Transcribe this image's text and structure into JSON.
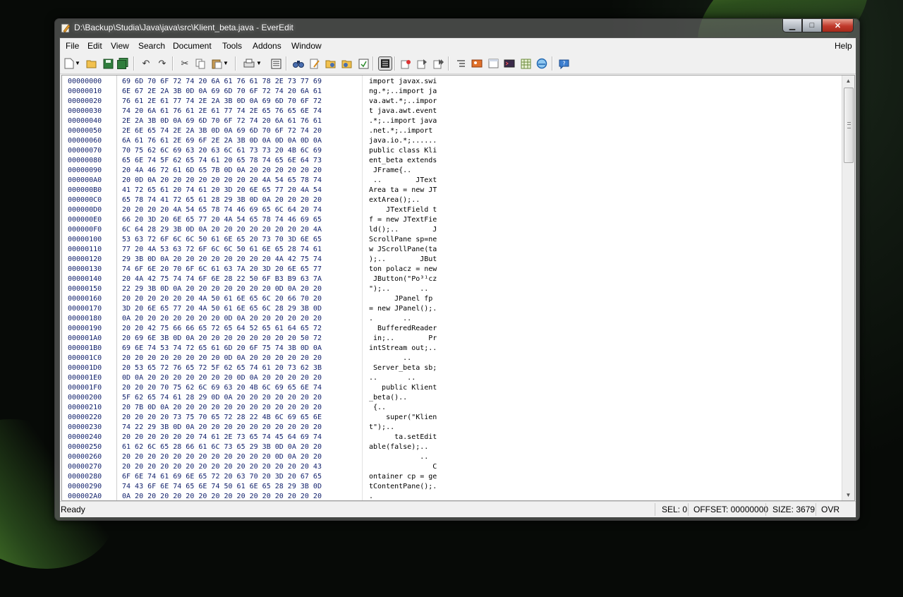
{
  "window": {
    "title": "D:\\Backup\\Studia\\Java\\java\\src\\Klient_beta.java - EverEdit",
    "controls": {
      "minimize": "▁",
      "maximize": "□",
      "close": "✕"
    }
  },
  "menu": {
    "file": "File",
    "edit": "Edit",
    "view": "View",
    "search": "Search",
    "document": "Document",
    "tools": "Tools",
    "addons": "Addons",
    "window": "Window",
    "help": "Help"
  },
  "toolbar": {
    "icons": [
      "new-icon",
      "open-icon",
      "save-icon",
      "save-all-icon",
      "undo-icon",
      "redo-icon",
      "cut-icon",
      "copy-icon",
      "paste-icon",
      "print-icon",
      "preview-icon",
      "find-icon",
      "replace-icon",
      "find-files-icon",
      "goto-icon",
      "hex-mode-icon",
      "record-icon",
      "play-icon",
      "play-multiple-icon",
      "outline-icon",
      "image-icon",
      "window-icon",
      "terminal-icon",
      "table-icon",
      "browser-icon",
      "help-icon"
    ]
  },
  "hex_rows": [
    {
      "off": "00000000",
      "hex": "69 6D 70 6F 72 74 20 6A 61 76 61 78 2E 73 77 69",
      "asc": "import javax.swi"
    },
    {
      "off": "00000010",
      "hex": "6E 67 2E 2A 3B 0D 0A 69 6D 70 6F 72 74 20 6A 61",
      "asc": "ng.*;..import ja"
    },
    {
      "off": "00000020",
      "hex": "76 61 2E 61 77 74 2E 2A 3B 0D 0A 69 6D 70 6F 72",
      "asc": "va.awt.*;..impor"
    },
    {
      "off": "00000030",
      "hex": "74 20 6A 61 76 61 2E 61 77 74 2E 65 76 65 6E 74",
      "asc": "t java.awt.event"
    },
    {
      "off": "00000040",
      "hex": "2E 2A 3B 0D 0A 69 6D 70 6F 72 74 20 6A 61 76 61",
      "asc": ".*;..import java"
    },
    {
      "off": "00000050",
      "hex": "2E 6E 65 74 2E 2A 3B 0D 0A 69 6D 70 6F 72 74 20",
      "asc": ".net.*;..import "
    },
    {
      "off": "00000060",
      "hex": "6A 61 76 61 2E 69 6F 2E 2A 3B 0D 0A 0D 0A 0D 0A",
      "asc": "java.io.*;......"
    },
    {
      "off": "00000070",
      "hex": "70 75 62 6C 69 63 20 63 6C 61 73 73 20 4B 6C 69",
      "asc": "public class Kli"
    },
    {
      "off": "00000080",
      "hex": "65 6E 74 5F 62 65 74 61 20 65 78 74 65 6E 64 73",
      "asc": "ent_beta extends"
    },
    {
      "off": "00000090",
      "hex": "20 4A 46 72 61 6D 65 7B 0D 0A 20 20 20 20 20 20",
      "asc": " JFrame{..      "
    },
    {
      "off": "000000A0",
      "hex": "20 0D 0A 20 20 20 20 20 20 20 20 4A 54 65 78 74",
      "asc": " ..        JText"
    },
    {
      "off": "000000B0",
      "hex": "41 72 65 61 20 74 61 20 3D 20 6E 65 77 20 4A 54",
      "asc": "Area ta = new JT"
    },
    {
      "off": "000000C0",
      "hex": "65 78 74 41 72 65 61 28 29 3B 0D 0A 20 20 20 20",
      "asc": "extArea();..    "
    },
    {
      "off": "000000D0",
      "hex": "20 20 20 20 4A 54 65 78 74 46 69 65 6C 64 20 74",
      "asc": "    JTextField t"
    },
    {
      "off": "000000E0",
      "hex": "66 20 3D 20 6E 65 77 20 4A 54 65 78 74 46 69 65",
      "asc": "f = new JTextFie"
    },
    {
      "off": "000000F0",
      "hex": "6C 64 28 29 3B 0D 0A 20 20 20 20 20 20 20 20 4A",
      "asc": "ld();..        J"
    },
    {
      "off": "00000100",
      "hex": "53 63 72 6F 6C 6C 50 61 6E 65 20 73 70 3D 6E 65",
      "asc": "ScrollPane sp=ne"
    },
    {
      "off": "00000110",
      "hex": "77 20 4A 53 63 72 6F 6C 6C 50 61 6E 65 28 74 61",
      "asc": "w JScrollPane(ta"
    },
    {
      "off": "00000120",
      "hex": "29 3B 0D 0A 20 20 20 20 20 20 20 20 4A 42 75 74",
      "asc": ");..        JBut"
    },
    {
      "off": "00000130",
      "hex": "74 6F 6E 20 70 6F 6C 61 63 7A 20 3D 20 6E 65 77",
      "asc": "ton polacz = new"
    },
    {
      "off": "00000140",
      "hex": "20 4A 42 75 74 74 6F 6E 28 22 50 6F B3 B9 63 7A",
      "asc": " JButton(\"Po³¹cz"
    },
    {
      "off": "00000150",
      "hex": "22 29 3B 0D 0A 20 20 20 20 20 20 20 0D 0A 20 20",
      "asc": "\");..       ..  "
    },
    {
      "off": "00000160",
      "hex": "20 20 20 20 20 20 4A 50 61 6E 65 6C 20 66 70 20",
      "asc": "      JPanel fp "
    },
    {
      "off": "00000170",
      "hex": "3D 20 6E 65 77 20 4A 50 61 6E 65 6C 28 29 3B 0D",
      "asc": "= new JPanel();."
    },
    {
      "off": "00000180",
      "hex": "0A 20 20 20 20 20 20 20 0D 0A 20 20 20 20 20 20",
      "asc": ".       ..      "
    },
    {
      "off": "00000190",
      "hex": "20 20 42 75 66 66 65 72 65 64 52 65 61 64 65 72",
      "asc": "  BufferedReader"
    },
    {
      "off": "000001A0",
      "hex": "20 69 6E 3B 0D 0A 20 20 20 20 20 20 20 20 50 72",
      "asc": " in;..        Pr"
    },
    {
      "off": "000001B0",
      "hex": "69 6E 74 53 74 72 65 61 6D 20 6F 75 74 3B 0D 0A",
      "asc": "intStream out;.."
    },
    {
      "off": "000001C0",
      "hex": "20 20 20 20 20 20 20 20 0D 0A 20 20 20 20 20 20",
      "asc": "        ..      "
    },
    {
      "off": "000001D0",
      "hex": "20 53 65 72 76 65 72 5F 62 65 74 61 20 73 62 3B",
      "asc": " Server_beta sb;"
    },
    {
      "off": "000001E0",
      "hex": "0D 0A 20 20 20 20 20 20 20 0D 0A 20 20 20 20 20",
      "asc": "..       ..     "
    },
    {
      "off": "000001F0",
      "hex": "20 20 20 70 75 62 6C 69 63 20 4B 6C 69 65 6E 74",
      "asc": "   public Klient"
    },
    {
      "off": "00000200",
      "hex": "5F 62 65 74 61 28 29 0D 0A 20 20 20 20 20 20 20",
      "asc": "_beta()..       "
    },
    {
      "off": "00000210",
      "hex": "20 7B 0D 0A 20 20 20 20 20 20 20 20 20 20 20 20",
      "asc": " {..            "
    },
    {
      "off": "00000220",
      "hex": "20 20 20 20 73 75 70 65 72 28 22 4B 6C 69 65 6E",
      "asc": "    super(\"Klien"
    },
    {
      "off": "00000230",
      "hex": "74 22 29 3B 0D 0A 20 20 20 20 20 20 20 20 20 20",
      "asc": "t\");..          "
    },
    {
      "off": "00000240",
      "hex": "20 20 20 20 20 20 74 61 2E 73 65 74 45 64 69 74",
      "asc": "      ta.setEdit"
    },
    {
      "off": "00000250",
      "hex": "61 62 6C 65 28 66 61 6C 73 65 29 3B 0D 0A 20 20",
      "asc": "able(false);..  "
    },
    {
      "off": "00000260",
      "hex": "20 20 20 20 20 20 20 20 20 20 20 20 0D 0A 20 20",
      "asc": "            ..  "
    },
    {
      "off": "00000270",
      "hex": "20 20 20 20 20 20 20 20 20 20 20 20 20 20 20 43",
      "asc": "               C"
    },
    {
      "off": "00000280",
      "hex": "6F 6E 74 61 69 6E 65 72 20 63 70 20 3D 20 67 65",
      "asc": "ontainer cp = ge"
    },
    {
      "off": "00000290",
      "hex": "74 43 6F 6E 74 65 6E 74 50 61 6E 65 28 29 3B 0D",
      "asc": "tContentPane();."
    },
    {
      "off": "000002A0",
      "hex": "0A 20 20 20 20 20 20 20 20 20 20 20 20 20 20 20",
      "asc": ".               "
    }
  ],
  "scrollbar": {
    "up": "▲",
    "down": "▼"
  },
  "status": {
    "ready": "Ready",
    "sel": "SEL: 0",
    "offset": "OFFSET: 00000000",
    "size": "SIZE: 3679",
    "mode": "OVR"
  }
}
